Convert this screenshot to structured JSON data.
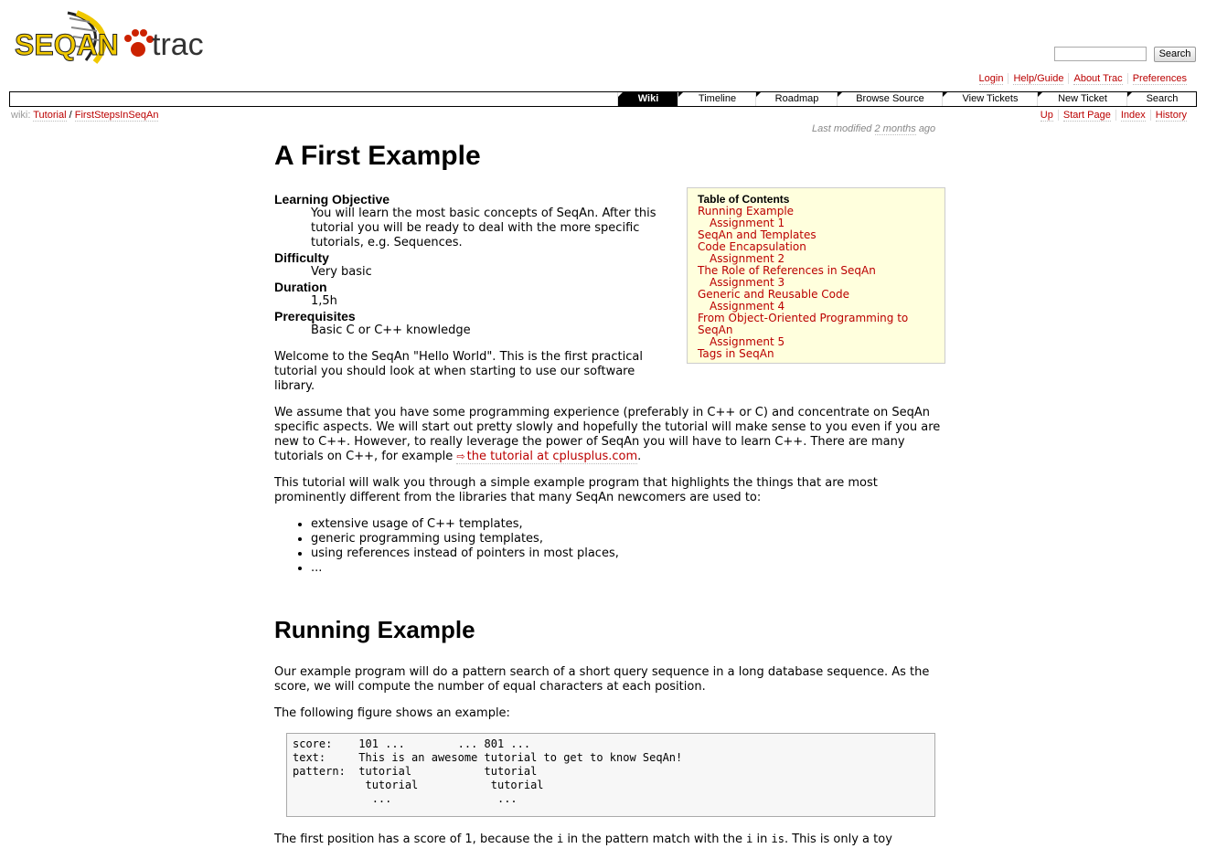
{
  "logo": {
    "text_left": "SEQAN",
    "text_right": "trac"
  },
  "search": {
    "placeholder": "",
    "button_label": "Search"
  },
  "metanav": [
    "Login",
    "Help/Guide",
    "About Trac",
    "Preferences"
  ],
  "mainnav": [
    {
      "label": "Wiki",
      "active": true
    },
    {
      "label": "Timeline",
      "active": false
    },
    {
      "label": "Roadmap",
      "active": false
    },
    {
      "label": "Browse Source",
      "active": false
    },
    {
      "label": "View Tickets",
      "active": false
    },
    {
      "label": "New Ticket",
      "active": false
    },
    {
      "label": "Search",
      "active": false
    }
  ],
  "breadcrumb": {
    "prefix": "wiki:",
    "parts": [
      "Tutorial",
      "FirstStepsInSeqAn"
    ],
    "sep": "/"
  },
  "ctxnav": [
    "Up",
    "Start Page",
    "Index",
    "History"
  ],
  "last_modified": {
    "prefix": "Last modified",
    "ago": "2 months",
    "suffix": "ago"
  },
  "page": {
    "title": "A First Example",
    "meta": [
      {
        "term": "Learning Objective",
        "desc": "You will learn the most basic concepts of SeqAn. After this tutorial you will be ready to deal with the more specific tutorials, e.g. Sequences."
      },
      {
        "term": "Difficulty",
        "desc": "Very basic"
      },
      {
        "term": "Duration",
        "desc": "1,5h"
      },
      {
        "term": "Prerequisites",
        "desc": "Basic C or C++ knowledge"
      }
    ],
    "intro": "Welcome to the SeqAn \"Hello World\". This is the first practical tutorial you should look at when starting to use our software library.",
    "para2": "We assume that you have some programming experience (preferably in C++ or C) and concentrate on SeqAn specific aspects. We will start out pretty slowly and hopefully the tutorial will make sense to you even if you are new to C++. However, to really leverage the power of SeqAn you will have to learn C++. There are many tutorials on C++, for example",
    "para2_link": "the tutorial at cplusplus.com",
    "para2_end": ".",
    "para3": "This tutorial will walk you through a simple example program that highlights the things that are most prominently different from the libraries that many SeqAn newcomers are used to:",
    "bullets": [
      "extensive usage of C++ templates,",
      "generic programming using templates,",
      "using references instead of pointers in most places,",
      "..."
    ],
    "h2": "Running Example",
    "para4": "Our example program will do a pattern search of a short query sequence in a long database sequence. As the score, we will compute the number of equal characters at each position.",
    "para5": "The following figure shows an example:",
    "code": "score:    101 ...        ... 801 ...\ntext:     This is an awesome tutorial to get to know SeqAn!\npattern:  tutorial           tutorial\n           tutorial           tutorial\n            ...                ...",
    "para6_a": "The first position has a score of 1, because the",
    "para6_code1": "i",
    "para6_b": "in the pattern match with the",
    "para6_code2": "i",
    "para6_c": "in",
    "para6_code3": "is",
    "para6_d": ". This is only a toy"
  },
  "toc": {
    "title": "Table of Contents",
    "items": [
      {
        "label": "Running Example",
        "sub": false
      },
      {
        "label": "Assignment 1",
        "sub": true
      },
      {
        "label": "SeqAn and Templates",
        "sub": false
      },
      {
        "label": "Code Encapsulation",
        "sub": false
      },
      {
        "label": "Assignment 2",
        "sub": true
      },
      {
        "label": "The Role of References in SeqAn",
        "sub": false
      },
      {
        "label": "Assignment 3",
        "sub": true
      },
      {
        "label": "Generic and Reusable Code",
        "sub": false
      },
      {
        "label": "Assignment 4",
        "sub": true
      },
      {
        "label": "From Object-Oriented Programming to SeqAn",
        "sub": false
      },
      {
        "label": "Assignment 5",
        "sub": true
      },
      {
        "label": "Tags in SeqAn",
        "sub": false
      }
    ]
  },
  "colors": {
    "link": "#bb0000",
    "toc_bg": "#ffffdd",
    "nav_active": "#000000",
    "logo_yellow": "#f0c800",
    "logo_red": "#cc2200"
  }
}
